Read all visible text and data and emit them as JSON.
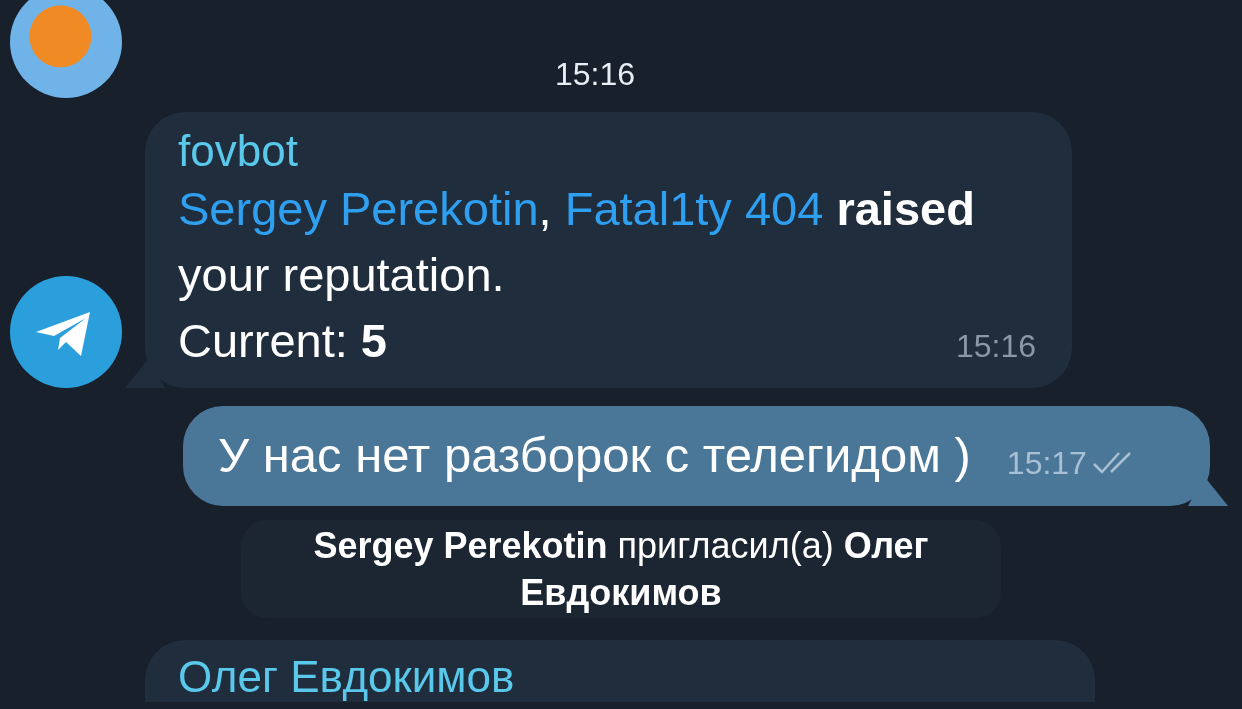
{
  "messages": [
    {
      "kind": "time_only",
      "time": "15:16"
    },
    {
      "kind": "incoming",
      "sender": "fovbot",
      "paragraphs": [
        {
          "parts": [
            {
              "kind": "link",
              "text": "Sergey Perekotin"
            },
            {
              "kind": "text",
              "text": ", "
            },
            {
              "kind": "link",
              "text": "Fatal1ty 404"
            },
            {
              "kind": "text",
              "text": " **raised** your reputation."
            }
          ]
        },
        {
          "parts": [
            {
              "kind": "text",
              "text": "Current: **5**"
            }
          ]
        }
      ],
      "time": "15:16"
    },
    {
      "kind": "outgoing",
      "text": "У нас нет разборок с телегидом )",
      "time": "15:17",
      "read": true
    },
    {
      "kind": "service",
      "text": "**Sergey Perekotin** пригласил(а) **Олег Евдокимов**"
    },
    {
      "kind": "incoming_partial",
      "sender": "Олег Евдокимов"
    }
  ]
}
